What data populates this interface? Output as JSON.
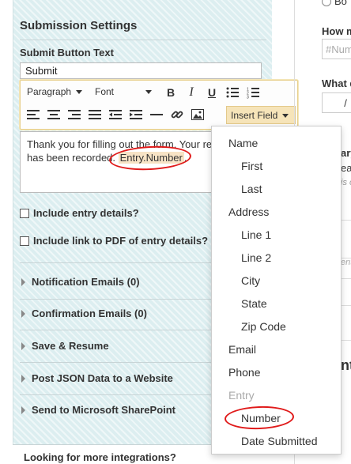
{
  "panel": {
    "title": "Submission Settings",
    "submit_label": "Submit Button Text",
    "submit_value": "Submit"
  },
  "toolbar": {
    "paragraph": "Paragraph",
    "font": "Font",
    "bold": "B",
    "italic": "I",
    "underline": "U",
    "insert_field": "Insert Field"
  },
  "editor": {
    "text_before": "Thank you for filling out the form. Your re",
    "text_line2_before": "has been recorded. ",
    "token": "Entry.Number",
    "text_after": "."
  },
  "checks": [
    {
      "label": "Include entry details?"
    },
    {
      "label": "Include link to PDF of entry details?"
    }
  ],
  "sections": [
    {
      "label": "Notification Emails (0)"
    },
    {
      "label": "Confirmation Emails (0)"
    },
    {
      "label": "Save & Resume"
    },
    {
      "label": "Post JSON Data to a Website"
    },
    {
      "label": "Send to Microsoft SharePoint"
    }
  ],
  "more": {
    "label": "Looking for more integrations?"
  },
  "right": {
    "r1": "Bo",
    "r2": "How m",
    "r3_placeholder": "#Num",
    "r4": "What d",
    "r5": "/",
    "r6": "ary",
    "r7": "eas",
    "r8": "is c",
    "r9": "ent",
    "r10": "nt"
  },
  "dropdown": {
    "items": [
      {
        "label": "Name",
        "level": "top"
      },
      {
        "label": "First",
        "level": "sub"
      },
      {
        "label": "Last",
        "level": "sub"
      },
      {
        "label": "Address",
        "level": "top"
      },
      {
        "label": "Line 1",
        "level": "sub"
      },
      {
        "label": "Line 2",
        "level": "sub"
      },
      {
        "label": "City",
        "level": "sub"
      },
      {
        "label": "State",
        "level": "sub"
      },
      {
        "label": "Zip Code",
        "level": "sub"
      },
      {
        "label": "Email",
        "level": "top"
      },
      {
        "label": "Phone",
        "level": "top"
      },
      {
        "label": "Entry",
        "level": "top"
      },
      {
        "label": "Number",
        "level": "sub"
      },
      {
        "label": "Date Submitted",
        "level": "sub"
      }
    ]
  },
  "colors": {
    "panel_bg": "#dceef0",
    "insert_field_bg": "#f6e4b9",
    "token_bg": "#f7e3c5",
    "annotation_red": "#e01a1a"
  }
}
